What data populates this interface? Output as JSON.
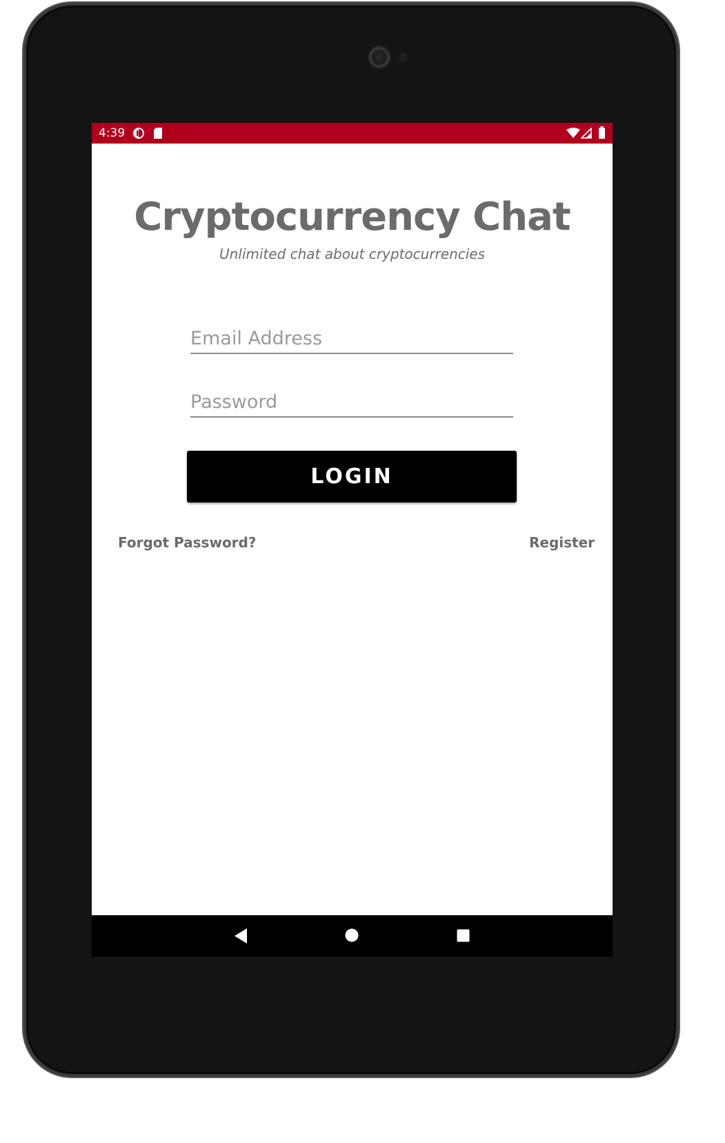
{
  "status_bar": {
    "time": "4:39",
    "color": "#b0001e",
    "left_icons": [
      "data-saver-icon",
      "sd-card-icon"
    ],
    "right_icons": [
      "wifi-icon",
      "signal-icon",
      "battery-icon"
    ]
  },
  "app": {
    "title": "Cryptocurrency Chat",
    "subtitle": "Unlimited chat about cryptocurrencies"
  },
  "form": {
    "email_placeholder": "Email Address",
    "email_value": "",
    "password_placeholder": "Password",
    "password_value": "",
    "login_label": "LOGIN",
    "forgot_password_label": "Forgot Password?",
    "register_label": "Register"
  },
  "nav_bar": {
    "buttons": [
      "back-icon",
      "home-icon",
      "recents-icon"
    ]
  }
}
